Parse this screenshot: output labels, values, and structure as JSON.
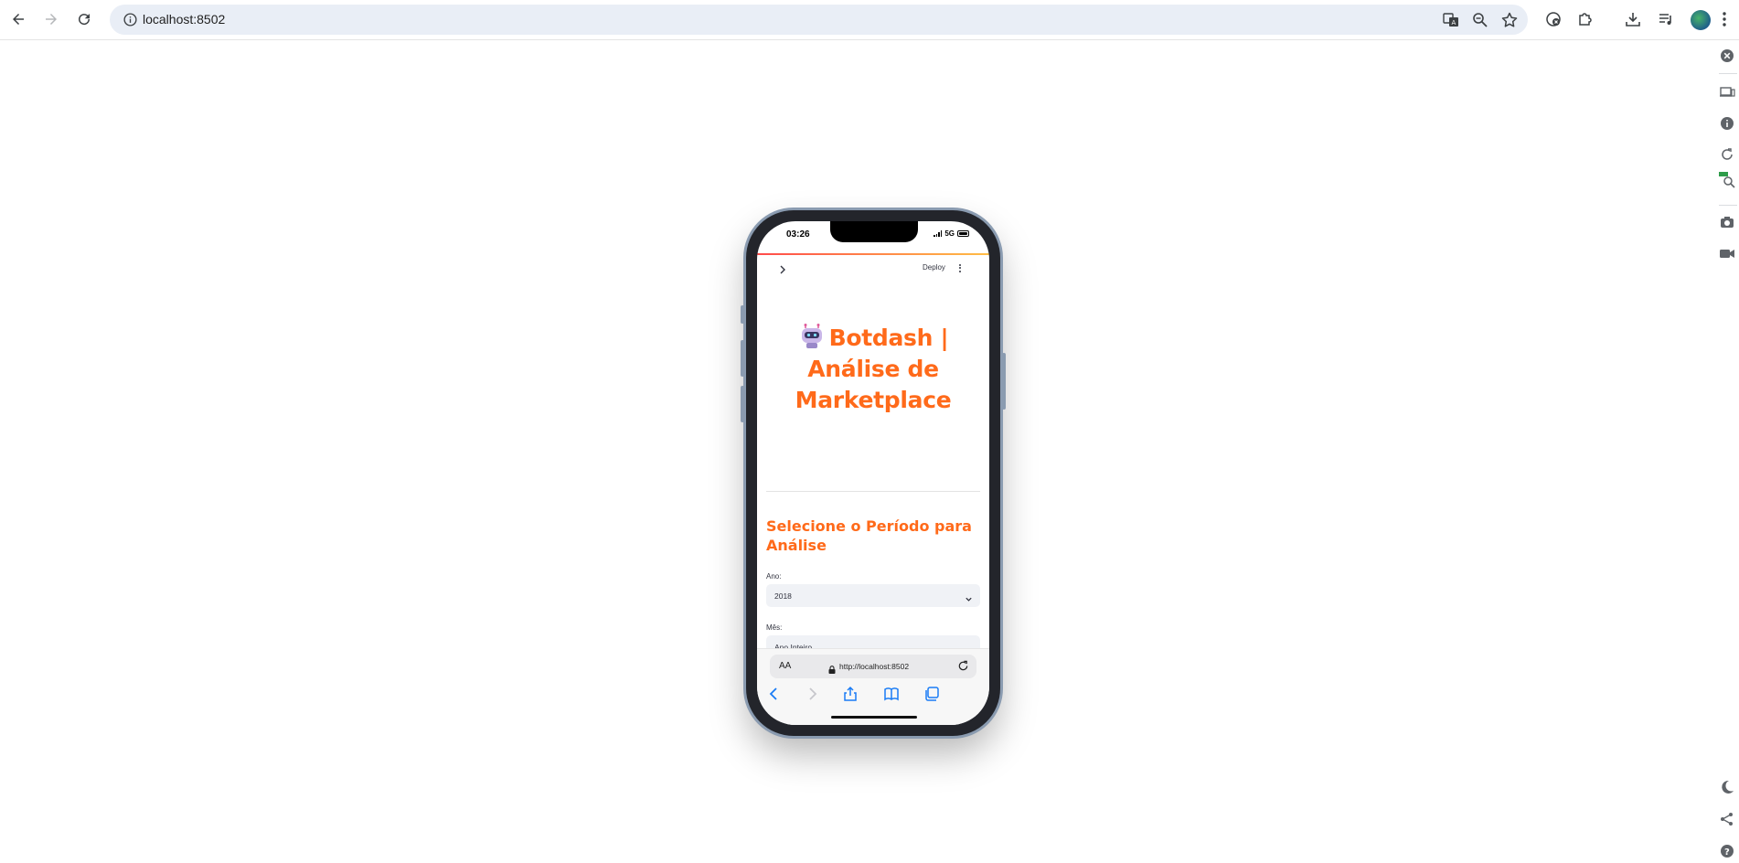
{
  "browser": {
    "url": "localhost:8502"
  },
  "phone": {
    "status_time": "03:26",
    "network": "5G",
    "header": {
      "deploy_label": "Deploy"
    },
    "app": {
      "title": "Botdash | Análise de Marketplace",
      "title_icon": "robot-emoji",
      "section_title": "Selecione o Período para Análise",
      "year_label": "Ano:",
      "year_value": "2018",
      "month_label": "Mês:",
      "month_value": "Ano Inteiro"
    },
    "safari": {
      "text_size_label": "AA",
      "url": "http://localhost:8502"
    }
  },
  "colors": {
    "accent": "#ff6a1a",
    "header_gradient_start": "#ff4b4b",
    "header_gradient_end": "#ffbd45",
    "safari_blue": "#1a7cf5"
  }
}
